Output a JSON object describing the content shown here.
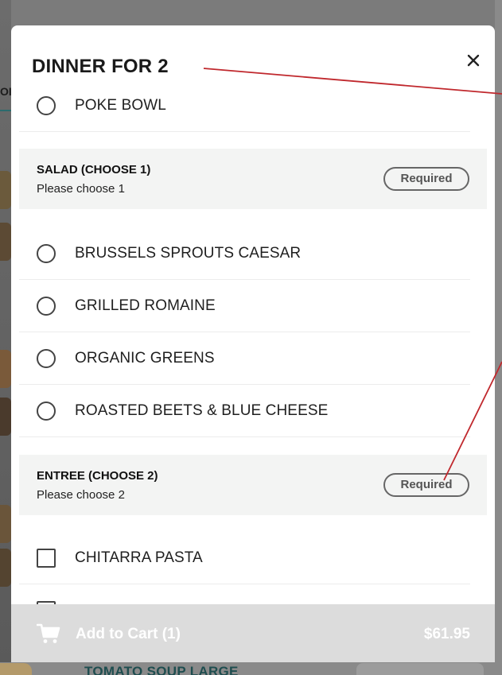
{
  "background": {
    "tab_fragment": "OI",
    "bottom_item_title": "TOMATO SOUP LARGE"
  },
  "modal": {
    "title": "DINNER FOR 2",
    "close_icon": "close-icon",
    "top_option": {
      "label": "POKE BOWL",
      "type": "radio",
      "selected": false
    },
    "sections": [
      {
        "title": "SALAD (CHOOSE 1)",
        "subtitle": "Please choose 1",
        "badge": "Required",
        "options": [
          {
            "label": "BRUSSELS SPROUTS CAESAR",
            "type": "radio",
            "selected": false
          },
          {
            "label": "GRILLED ROMAINE",
            "type": "radio",
            "selected": false
          },
          {
            "label": "ORGANIC GREENS",
            "type": "radio",
            "selected": false
          },
          {
            "label": "ROASTED BEETS & BLUE CHEESE",
            "type": "radio",
            "selected": false
          }
        ]
      },
      {
        "title": "ENTREE (CHOOSE 2)",
        "subtitle": "Please choose 2",
        "badge": "Required",
        "options": [
          {
            "label": "CHITARRA PASTA",
            "type": "checkbox",
            "selected": false
          },
          {
            "label": "",
            "type": "checkbox",
            "selected": false
          }
        ]
      }
    ],
    "cart": {
      "icon": "cart-icon",
      "label": "Add to Cart (1)",
      "price": "$61.95"
    }
  },
  "colors": {
    "annotation_red": "#c0282d",
    "cart_bar_disabled": "#dcdcdc",
    "section_header_bg": "#f3f4f3",
    "overlay": "#7b7b7b"
  }
}
